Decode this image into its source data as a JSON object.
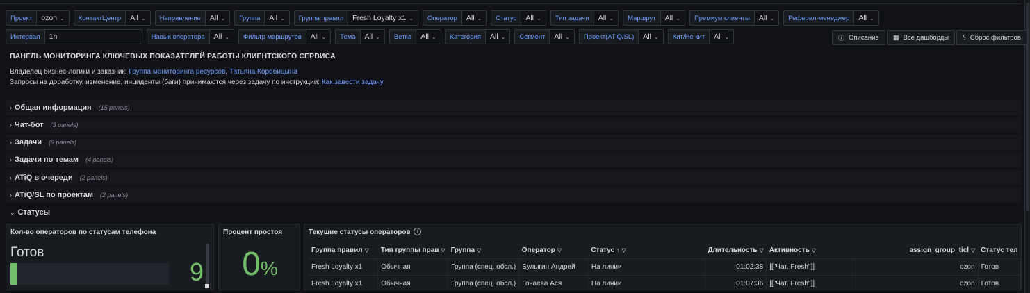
{
  "variables_row1": [
    {
      "label": "Проект",
      "value": "ozon"
    },
    {
      "label": "КонтактЦентр",
      "value": "All"
    },
    {
      "label": "Направление",
      "value": "All"
    },
    {
      "label": "Группа",
      "value": "All"
    },
    {
      "label": "Группа правил",
      "value": "Fresh Loyalty x1"
    },
    {
      "label": "Оператор",
      "value": "All"
    },
    {
      "label": "Статус",
      "value": "All"
    },
    {
      "label": "Тип задачи",
      "value": "All"
    },
    {
      "label": "Маршрут",
      "value": "All"
    },
    {
      "label": "Премиум клиенты",
      "value": "All"
    },
    {
      "label": "Реферал-менеджер",
      "value": "All"
    }
  ],
  "variables_row2": {
    "interval": {
      "label": "Интервал",
      "value": "1h"
    },
    "items": [
      {
        "label": "Навык оператора",
        "value": "All"
      },
      {
        "label": "Фильтр маршрутов",
        "value": "All"
      },
      {
        "label": "Тема",
        "value": "All"
      },
      {
        "label": "Ветка",
        "value": "All"
      },
      {
        "label": "Категория",
        "value": "All"
      },
      {
        "label": "Сегмент",
        "value": "All"
      },
      {
        "label": "Проект(ATiQ/SL)",
        "value": "All"
      },
      {
        "label": "Кит/Не кит",
        "value": "All"
      }
    ]
  },
  "buttons": {
    "description": "Описание",
    "all_dashboards": "Все дашборды",
    "reset_filters": "Сброс фильтров"
  },
  "header": {
    "title": "ПАНЕЛЬ МОНИТОРИНГА КЛЮЧЕВЫХ ПОКАЗАТЕЛЕЙ РАБОТЫ КЛИЕНТСКОГО СЕРВИСА",
    "owner_prefix": "Владелец бизнес-логики и заказчик: ",
    "owner_link1": "Группа мониторинга ресурсов",
    "owner_sep": ", ",
    "owner_link2": "Татьяна Коробицына",
    "requests_prefix": "Запросы на доработку, изменение, инциденты (баги) принимаются через задачу по инструкции: ",
    "requests_link": "Как завести задачу"
  },
  "rows": [
    {
      "title": "Общая информация",
      "count": "(15 panels)"
    },
    {
      "title": "Чат-бот",
      "count": "(3 panels)"
    },
    {
      "title": "Задачи",
      "count": "(9 panels)"
    },
    {
      "title": "Задачи по темам",
      "count": "(4 panels)"
    },
    {
      "title": "ATiQ в очереди",
      "count": "(2 panels)"
    },
    {
      "title": "ATiQ/SL по проектам",
      "count": "(2 panels)"
    }
  ],
  "statuses_row": {
    "title": "Статусы"
  },
  "panel_operators_by_phone": {
    "title": "Кол-во операторов по статусам телефона",
    "label": "Готов",
    "value": "9",
    "fill_fraction": 0.04,
    "color": "#73bf69"
  },
  "panel_idle": {
    "title": "Процент простоя",
    "value": "0",
    "unit": "%"
  },
  "panel_statuses": {
    "title": "Текущие статусы операторов",
    "columns": [
      "Группа правил",
      "Тип группы прав",
      "Группа",
      "Оператор",
      "Статус",
      "Длительность",
      "Активность",
      "assign_group_ticl",
      "Статус тел"
    ],
    "rows": [
      [
        "Fresh Loyalty x1",
        "Обычная",
        "Группа (спец. обсл.)",
        "Булыгин Андрей",
        "На линии",
        "01:02:38",
        "[[\"Чат. Fresh\"]]",
        "ozon",
        "Готов"
      ],
      [
        "Fresh Loyalty x1",
        "Обычная",
        "Группа (спец. обсл.)",
        "Гочаева Ася",
        "На линии",
        "01:07:36",
        "[[\"Чат. Fresh\"]]",
        "ozon",
        "Готов"
      ]
    ]
  }
}
